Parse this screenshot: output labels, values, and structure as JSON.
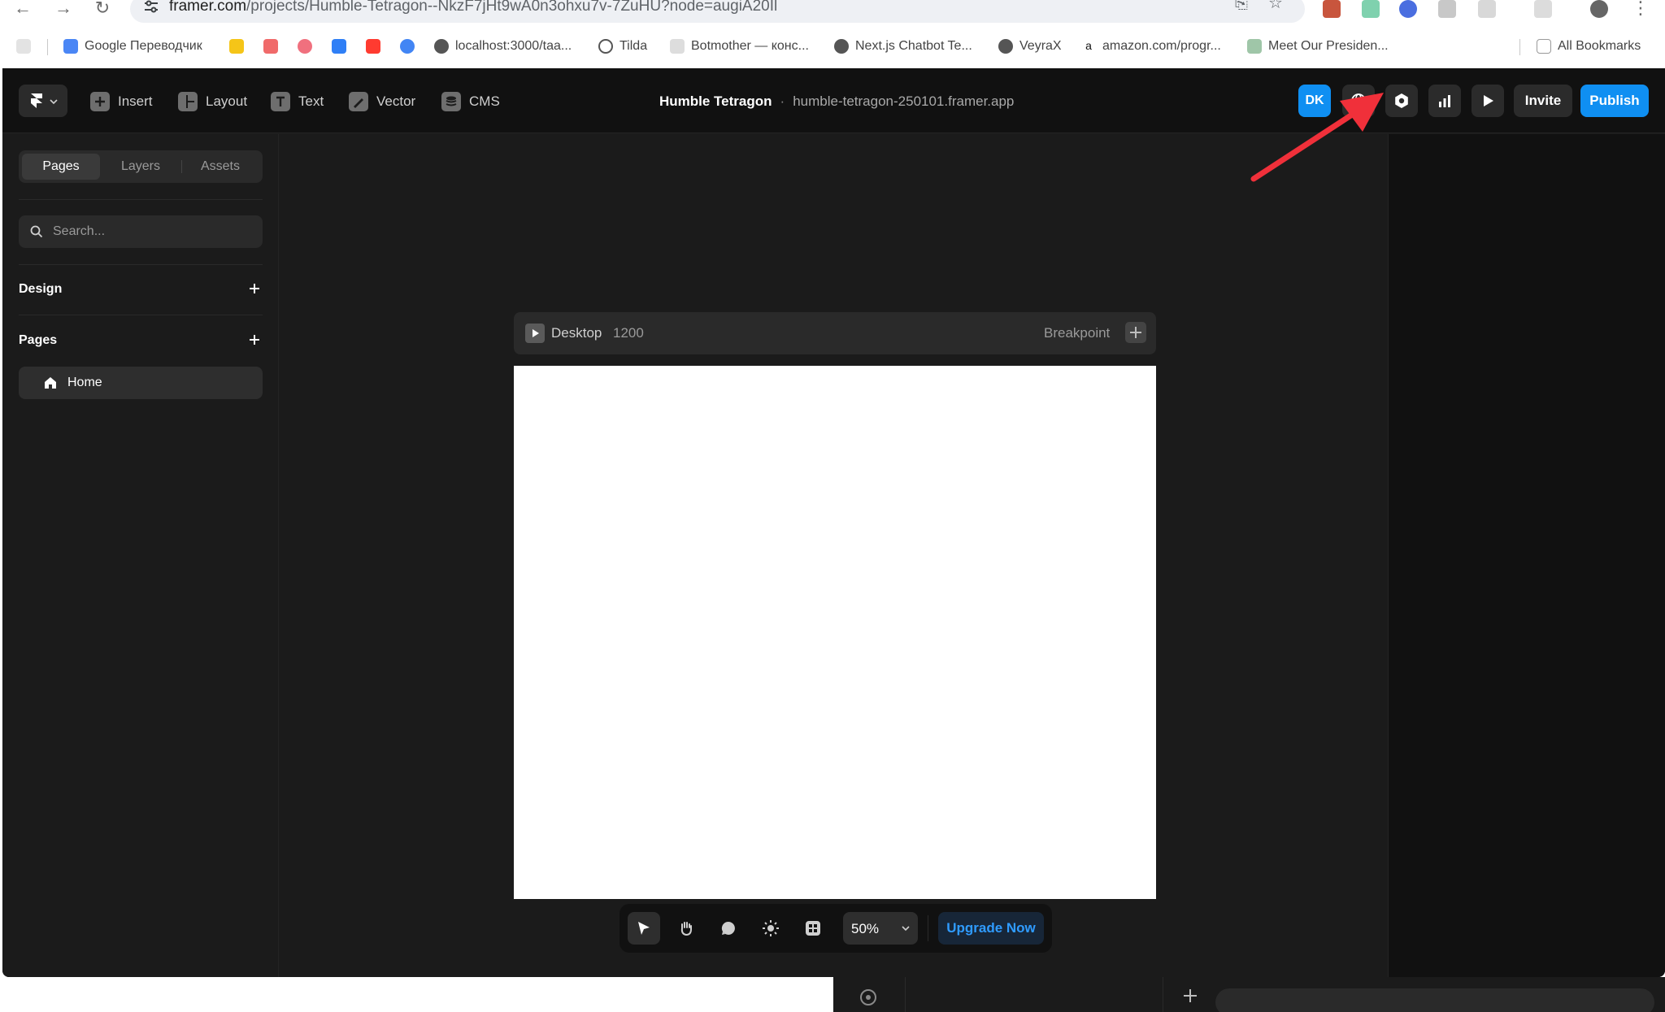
{
  "browser": {
    "url_host": "framer.com",
    "url_path": "/projects/Humble-Tetragon--NkzF7jHt9wA0n3ohxu7v-7ZuHU?node=augiA20Il",
    "bookmarks": [
      {
        "label": "Google Переводчик",
        "color": "#4a86f5"
      },
      {
        "label": "",
        "color": "#f5c518"
      },
      {
        "label": "",
        "color": "#f06a6a"
      },
      {
        "label": "",
        "color": "#f0707e"
      },
      {
        "label": "",
        "color": "#2f7ff6"
      },
      {
        "label": "",
        "color": "#ff3b30"
      },
      {
        "label": "",
        "color": "#4285f4"
      },
      {
        "label": "localhost:3000/taa...",
        "color": "#444444"
      },
      {
        "label": "Tilda",
        "color": "#444444"
      },
      {
        "label": "Botmother — конс...",
        "color": "#444444"
      },
      {
        "label": "Next.js Chatbot Te...",
        "color": "#444444"
      },
      {
        "label": "VeyraX",
        "color": "#444444"
      },
      {
        "label": "amazon.com/progr...",
        "color": "#444444"
      },
      {
        "label": "Meet Our Presiden...",
        "color": "#444444"
      }
    ],
    "all_bookmarks": "All Bookmarks"
  },
  "toolbar": {
    "tools": [
      {
        "label": "Insert",
        "icon": "plus-square-icon"
      },
      {
        "label": "Layout",
        "icon": "layout-icon"
      },
      {
        "label": "Text",
        "icon": "text-icon"
      },
      {
        "label": "Vector",
        "icon": "pen-icon"
      },
      {
        "label": "CMS",
        "icon": "database-icon"
      }
    ],
    "project_name": "Humble Tetragon",
    "separator": "·",
    "project_domain": "humble-tetragon-250101.framer.app",
    "avatar_initials": "DK",
    "invite_label": "Invite",
    "publish_label": "Publish",
    "accent": "#0f8ff2"
  },
  "left_panel": {
    "tabs": [
      "Pages",
      "Layers",
      "Assets"
    ],
    "active_tab": "Pages",
    "search_placeholder": "Search...",
    "design_title": "Design",
    "pages_title": "Pages",
    "pages": [
      {
        "label": "Home",
        "icon": "home-icon"
      }
    ]
  },
  "canvas": {
    "frame_label": "Desktop",
    "frame_width": "1200",
    "breakpoint_label": "Breakpoint"
  },
  "bottom_bar": {
    "zoom": "50%",
    "upgrade_label": "Upgrade Now"
  }
}
